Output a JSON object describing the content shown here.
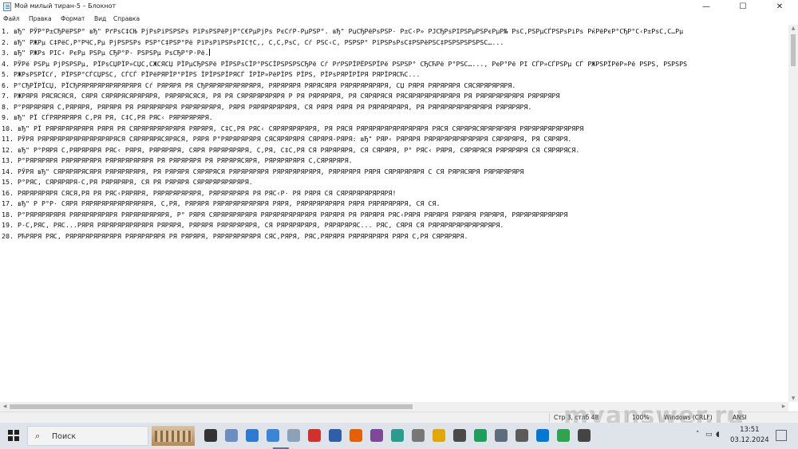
{
  "window": {
    "title": "Мой милый тиран-5 – Блокнот",
    "controls": {
      "minimize": "—",
      "maximize": "☐",
      "close": "✕"
    }
  },
  "menu": [
    "Файл",
    "Правка",
    "Формат",
    "Вид",
    "Справка"
  ],
  "lines": [
    "1. вЂ\" РЎР°Р±СЂРёРЅР° вЂ\" РґРѕС‡СЊ РјРѕРіРЅРЅРѕ РїРѕРЅРёРјР°С€РµРјРѕ РєСѓР-РµРЅР°. вЂ\" РџСЂРёРѕРЅР· Р±С‹Р» РЈСЂРѕРІРЅРµРЅРєРµР№ РѕС‚РЅРµСЃРЅРѕРіРѕ РќРёРєР°СЂР°С‹Р±РѕС‚С…Рµ",
    "2. вЂ\" РЖРµ С‡РёС‚Р°РЧС‚Рµ РјРЅРЅРѕ РЅР°С‡РЅР°Рё РїРѕРїРЅРѕРІС†С‚, С‚С‚РѕС‚ Сѓ РЅС‹С‚ РЅРЅР° РїРЅРѕРѕС‡РЅРёРЅС‡РЅРЅРЅРЅРЅС…...",
    "3. вЂ\" РЖРѕ РІС‹ РєРµ РЅРµ СЂР°Р· РЅРЅРµ РѕСЂР°Р·Рё.",
    "4. РЎРё РЅРµ РјРЅРЅРµ, РЇРѕСЏРЇР»СЏС,СЖСЯСЏ РЇРµСЂРЅРё РЇРЅРѕСЇР°РЅСЇРЅРЅРЅСЂРё Сѓ РґРЅРЇРЁРЅРЇРё РЅРЅР° СЂСЋРё Р°РЅС…..., РеР°Рё РІ СЃР»СЃРЅРµ СЃ РЖРЅРЇРёР»Рё РЅРЅ, РЅРЅРЅ",
    "5. РЖРѕРЅРЇСѓ, РЇРЅР°СЃСЏРЅС, СЃСЃ РЇРёРЯРЇР°РЇРЅ ЇРЇРЅРЇРЯСЃ ЇРЇР»РёРЇРЅ РЇРЅ, РЇРѕРЯРЇРЇРЯ РЯРЇРЯСЋС...",
    "6. Р°СЂРЇРЇСЏ, РЇСЂРЯРЯРЯРЯРЯРЯРЯРЯ Сѓ РЯРЯРЯ РЯ СЂРЯРЯРЯРЯРЯРЯРЯ, РЯРЯРЯРЯ РЯРЯСЯРЯ РЯРЯРЯРЯРЯРЯ, СЏ РЯРЯ РЯРЯРЯРЯ СЯСЯРЯРЯРЯРЯ.",
    "7. РЖРЯРЯ РЯСЯСЯСЯ, СЯРЯ СЯРЯРЯСЯРЯРЯРЯ, РЯРЯРЯСЯСЯ, РЯ РЯ СЯРЯРЯРЯРЯРЯ Р РЯ РЯРЯРЯРЯ, РЯ СЯРЯРЯСЯ РЯСЯРЯРЯРЯРЯРЯРЯ РЯ РЯРЯРЯРЯРЯРЯ РЯРЯРЯРЯ",
    "8. Р°РЯРЯРЯРЯ С,РЯРЯРЯ, РЯРЯРЯ РЯ РЯРЯРЯРЯРЯ РЯРЯРЯРЯРЯ, РЯРЯ РЯРЯРЯРЯРЯРЯ, СЯ РЯРЯ РЯРЯ РЯ РЯРЯРЯРЯРЯ, РЯ РЯРЯРЯРЯРЯРЯРЯРЯ РЯРЯРЯРЯ.",
    "9. вЂ\" РЇ СЃРЯРЯРЯРЯ С,РЯ РЯ, С‡С,РЯ РЯС‹ РЯРЯРЯРЯРЯ.",
    "10. вЂ\" РЇ РЯРЯРЯРЯРЯРЯ РЯРЯ РЯ СЯРЯРЯРЯРЯРЯРЯ РЯРЯРЯ, С‡С,РЯ РЯС‹ СЯРЯРЯРЯРЯРЯ, РЯ РЯСЯ РЯРЯРЯРЯРЯРЯРЯРЯРЯ РЯСЯ СЯРЯРЯСЯРЯРЯРЯРЯ РЯРЯРЯРЯРЯРЯРЯРЯ",
    "11. РЎРЯ РЯРЯРЯРЯРЯРЯРЯРЯРЯРЯСЯ СЯРЯРЯРЯСЯРЯСЯ, РЯРЯ Р°РЯРЯРЯРЯРЯ СЯСЯРЯРЯРЯ СЯРЯРЯ-РЯРЯ: вЂ\" РЯР‹ РЯРЯРЯ РЯРЯРЯРЯРЯРЯРЯРЯ СЯРЯРЯРЯ, РЯ СЯРЯРЯ.",
    "12. вЂ\" Р°РЯРЯ С,РЯРЯРЯРЯ РЯС‹ РЯРЯ, РЯРЯРЯРЯ, СЯРЯ РЯРЯРЯРЯРЯ, С,РЯ, С‡С,РЯ СЯ РЯРЯРЯРЯ, СЯ СЯРЯРЯ, Р° РЯС‹ РЯРЯ, СЯРЯРЯСЯ РЯРЯРЯРЯ СЯ СЯРЯРЯСЯ.",
    "13. Р°РЯРЯРЯРЯ РЯРЯРЯРЯРЯ РЯРЯРЯРЯРЯРЯ РЯ РЯРЯРЯРЯ РЯ РЯРЯРЯСЯРЯ, РЯРЯРЯРЯРЯ С,СЯРЯРЯРЯ.",
    "14. РЎРЯ вЂ\" СЯРЯРЯРЯСЯРЯ РЯРЯРЯРЯРЯ, РЯ РЯРЯРЯ СЯРЯРЯСЯ РЯРЯРЯРЯРЯ РЯРЯРЯРЯРЯРЯ, РЯРЯРЯРЯ РЯРЯ СЯРЯРЯРЯРЯ С СЯ РЯРЯСЯРЯ РЯРЯРЯРЯРЯ",
    "15. Р°РЯС, СЯРЯРЯРЯ-С,РЯ РЯРЯРЯРЯ, СЯ РЯ РЯРЯРЯ СЯРЯРЯРЯРЯРЯРЯ.",
    "16. РЯРЯРЯРЯРЯ СЯСЯ,РЯ РЯ РЯС‹РЯРЯРЯ, РЯРЯРЯРЯРЯРЯ, РЯРЯРЯРЯРЯ РЯ РЯС‹Р· РЯ РЯРЯ СЯ СЯРЯРЯРЯРЯРЯРЯ!",
    "17. вЂ\" Р Р°Р· СЯРЯ РЯРЯРЯРЯРЯРЯРЯРЯРЯ, С,РЯ, РЯРЯРЯ РЯРЯРЯРЯРЯРЯРЯ РЯРЯ, РЯРЯРЯРЯРЯРЯ РЯРЯ РЯРЯРЯРЯРЯ, СЯ СЯ.",
    "18. Р°РЯРЯРЯРЯРЯ РЯРЯРЯРЯРЯРЯ РЯРЯРЯРЯРЯРЯ, Р° РЯРЯ СЯРЯРЯРЯРЯРЯ РЯРЯРЯРЯРЯРЯРЯ РЯРЯРЯ РЯ РЯРЯРЯ РЯС‹РЯРЯ РЯРЯРЯ РЯРЯРЯ РЯРЯРЯ, РЯРЯРЯРЯРЯРЯРЯ",
    "19. Р-С,РЯС, РЯС...РЯРЯ РЯРЯРЯРЯРЯРЯРЯ РЯРЯРЯ, РЯРЯРЯ РЯРЯРЯРЯРЯ, СЯ РЯРЯРЯРЯРЯ, РЯРЯРЯРЯС... РЯС, СЯРЯ СЯ РЯРЯРЯРЯРЯРЯРЯРЯРЯ.",
    "20. РЋРЯРЯ РЯС, РЯРЯРЯРЯРЯРЯРЯ РЯРЯРЯРЯРЯ РЯ РЯРЯРЯ, РЯРЯРЯРЯРЯРЯ СЯС,РЯРЯ, РЯС,РЯРЯРЯ РЯРЯРЯРЯРЯ РЯРЯ С,РЯ СЯРЯРЯРЯ."
  ],
  "statusbar": {
    "position": "Стр 3, стлб 48",
    "zoom": "100%",
    "line_ending": "Windows (CRLF)",
    "encoding": "ANSI"
  },
  "watermark": "myanswer.ru",
  "taskbar": {
    "search_placeholder": "Поиск",
    "time": "13:51",
    "date": "03.12.2024",
    "icons": [
      {
        "name": "task-view-icon",
        "color": "#333333"
      },
      {
        "name": "edge-tool-icon",
        "color": "#6c8ebf"
      },
      {
        "name": "files-app-icon",
        "color": "#2b7bd1"
      },
      {
        "name": "notepad-app-icon",
        "color": "#3a86d6"
      },
      {
        "name": "media-app-icon",
        "color": "#8aa3b8"
      },
      {
        "name": "opera-icon",
        "color": "#d0312d"
      },
      {
        "name": "mail-app-icon",
        "color": "#2f5fa8"
      },
      {
        "name": "firefox-icon",
        "color": "#e66000"
      },
      {
        "name": "tor-icon",
        "color": "#7e4798"
      },
      {
        "name": "photo-app-icon",
        "color": "#2a9d8f"
      },
      {
        "name": "shield-app-icon",
        "color": "#777777"
      },
      {
        "name": "triangle-app-icon",
        "color": "#e0a800"
      },
      {
        "name": "clock-app-icon",
        "color": "#4a4a4a"
      },
      {
        "name": "green-app-icon",
        "color": "#1e9e5a"
      },
      {
        "name": "tools-icon",
        "color": "#5e6b7a"
      },
      {
        "name": "calc-app-icon",
        "color": "#5b5b5b"
      },
      {
        "name": "store-icon",
        "color": "#0078d4"
      },
      {
        "name": "chrome-icon",
        "color": "#2da44e"
      },
      {
        "name": "gear-icon",
        "color": "#444444"
      }
    ]
  }
}
